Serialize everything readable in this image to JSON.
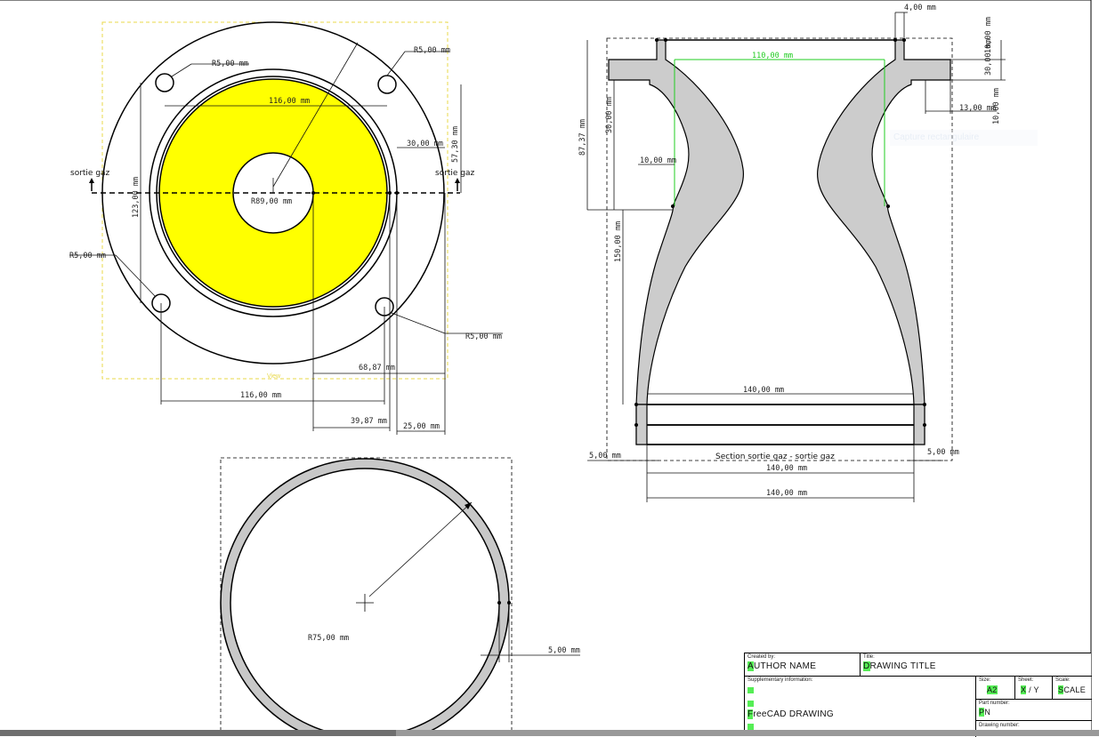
{
  "top_view": {
    "dims": {
      "r_top_right": "R5,00 mm",
      "r_top_left": "R5,00 mm",
      "d_inner": "116,00 mm",
      "d_30": "30,00 mm",
      "d_57": "57,30 mm",
      "sortie_left": "sortie gaz",
      "sortie_right": "sortie gaz",
      "d_vert_left": "123,00 mm",
      "r_89": "R89,00 mm",
      "r_left": "R5,00 mm",
      "r_bottom_right": "R5,00 mm",
      "d_68": "68,87 mm",
      "d_116b": "116,00 mm",
      "d_39": "39,87 mm",
      "d_25": "25,00 mm",
      "view_label": "View"
    },
    "colors": {
      "fill": "#ffff00",
      "frame": "#e8d84a"
    }
  },
  "section_view": {
    "dims": {
      "top_4": "4,00 mm",
      "green_110": "110,00 mm",
      "v_right_top": "10,00 mm",
      "v_right_mid": "30,00 mm",
      "h_13": "13,00 mm",
      "v_right_bot": "10,00 mm",
      "v_87": "87,37 mm",
      "v_30": "30,00 mm",
      "h_10": "10,00 mm",
      "v_150": "150,00 mm",
      "h_140_top": "140,00 mm",
      "left_5": "5,00 mm",
      "right_5": "5,00 mm",
      "section_label": "Section sortie gaz - sortie gaz",
      "h_140_mid": "140,00 mm",
      "h_140_bot": "140,00 mm"
    },
    "colors": {
      "fill": "#cccccc",
      "green": "#22cc22"
    },
    "capture_hint": "Capture rectangulaire"
  },
  "ring_view": {
    "dims": {
      "r_75": "R75,00 mm",
      "w_5": "5,00 mm"
    },
    "colors": {
      "fill": "#c8c8c8"
    }
  },
  "title_block": {
    "created_by_label": "Created by:",
    "author_first": "A",
    "author_rest": "UTHOR NAME",
    "title_label": "Title:",
    "title_first": "D",
    "title_rest": "RAWING TITLE",
    "supplementary_label": "Supplementary information:",
    "freecad_first": "F",
    "freecad_rest": "reeCAD DRAWING",
    "size_label": "Size:",
    "size_value": "A2",
    "sheet_label": "Sheet:",
    "sheet_x": "X",
    "sheet_rest": " / Y",
    "scale_label": "Scale:",
    "scale_first": "S",
    "scale_rest": "CALE",
    "part_number_label": "Part number:",
    "part_first": "P",
    "part_rest": "N",
    "drawing_number_label": "Drawing number:",
    "highlight_color": "#55ee55"
  }
}
